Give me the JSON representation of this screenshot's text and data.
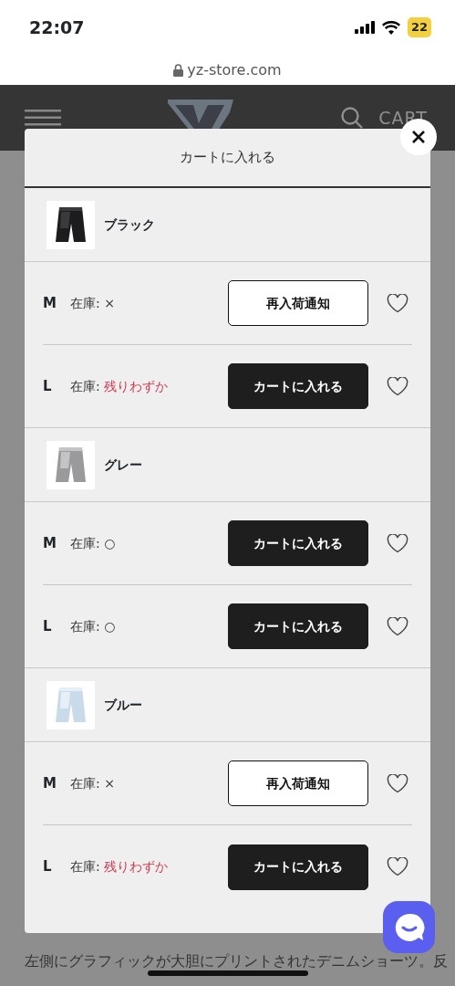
{
  "status_bar": {
    "time": "22:07",
    "battery": "22"
  },
  "address_bar": {
    "url": "yz-store.com"
  },
  "header": {
    "cart": "CART"
  },
  "modal": {
    "title": "カートに入れる",
    "variants": [
      {
        "color_name": "ブラック",
        "sizes": [
          {
            "size": "M",
            "stock_label": "在庫:",
            "stock": "×",
            "low_stock": false,
            "button": "再入荷通知",
            "kind": "notify",
            "favorite": false
          },
          {
            "size": "L",
            "stock_label": "在庫:",
            "stock": "残りわずか",
            "low_stock": true,
            "button": "カートに入れる",
            "kind": "cart",
            "favorite": false
          }
        ]
      },
      {
        "color_name": "グレー",
        "sizes": [
          {
            "size": "M",
            "stock_label": "在庫:",
            "stock": "○",
            "low_stock": false,
            "button": "カートに入れる",
            "kind": "cart",
            "favorite": false
          },
          {
            "size": "L",
            "stock_label": "在庫:",
            "stock": "○",
            "low_stock": false,
            "button": "カートに入れる",
            "kind": "cart",
            "favorite": false
          }
        ]
      },
      {
        "color_name": "ブルー",
        "sizes": [
          {
            "size": "M",
            "stock_label": "在庫:",
            "stock": "×",
            "low_stock": false,
            "button": "再入荷通知",
            "kind": "notify",
            "favorite": false
          },
          {
            "size": "L",
            "stock_label": "在庫:",
            "stock": "残りわずか",
            "low_stock": true,
            "button": "カートに入れる",
            "kind": "cart",
            "favorite": false
          }
        ]
      }
    ]
  },
  "description": "左側にグラフィックが大胆にプリントされたデニムショーツ。反"
}
